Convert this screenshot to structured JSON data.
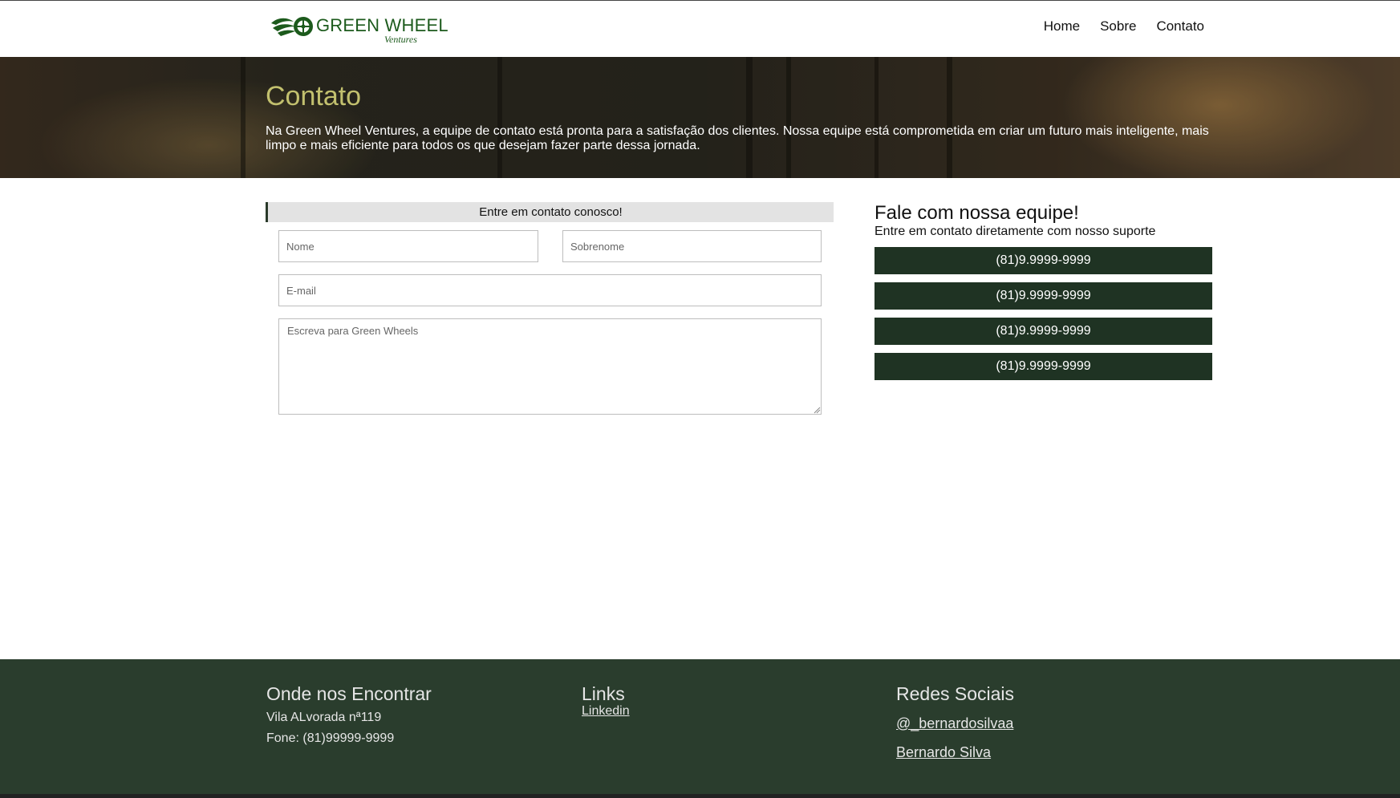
{
  "header": {
    "logo_title": "GREEN WHEEL",
    "logo_subtitle": "Ventures",
    "nav": [
      {
        "label": "Home"
      },
      {
        "label": "Sobre"
      },
      {
        "label": "Contato"
      }
    ]
  },
  "hero": {
    "title": "Contato",
    "text": "Na Green Wheel Ventures, a equipe de contato está pronta para a satisfação dos clientes. Nossa equipe está comprometida em criar um futuro mais inteligente, mais limpo e mais eficiente para todos os que desejam fazer parte dessa jornada."
  },
  "form": {
    "header": "Entre em contato conosco!",
    "nome_placeholder": "Nome",
    "sobrenome_placeholder": "Sobrenome",
    "email_placeholder": "E-mail",
    "message_placeholder": "Escreva para Green Wheels"
  },
  "team": {
    "title": "Fale com nossa equipe!",
    "subtitle": "Entre em contato diretamente com nosso suporte",
    "phones": [
      "(81)9.9999-9999",
      "(81)9.9999-9999",
      "(81)9.9999-9999",
      "(81)9.9999-9999"
    ]
  },
  "footer": {
    "location": {
      "title": "Onde nos Encontrar",
      "address": "Vila ALvorada nª119",
      "phone": "Fone: (81)99999-9999"
    },
    "links": {
      "title": "Links",
      "items": [
        "Linkedin"
      ]
    },
    "social": {
      "title": "Redes Sociais",
      "items": [
        "@_bernardosilvaa",
        "Bernardo Silva"
      ]
    }
  },
  "colors": {
    "brand_green": "#1c5a1c",
    "hero_title": "#c2c06e",
    "button_bg": "#1f3323",
    "footer_bg": "#2a3d2d"
  }
}
